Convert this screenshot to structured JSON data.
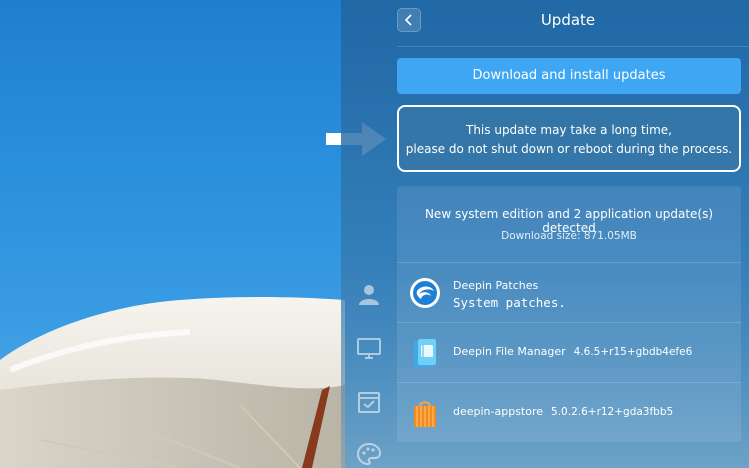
{
  "panel": {
    "title": "Update",
    "download_button_label": "Download and install updates",
    "warning": {
      "line1": "This update may take a long time,",
      "line2": "please do not shut down or reboot during the process."
    },
    "summary": {
      "title": "New system edition and 2 application update(s) detected",
      "size": "Download size: 871.05MB"
    },
    "items": [
      {
        "name": "Deepin Patches",
        "version": "",
        "description": "System patches.",
        "icon": "deepin-logo-icon"
      },
      {
        "name": "Deepin File Manager",
        "version": "4.6.5+r15+gbdb4efe6",
        "description": "",
        "icon": "file-manager-icon"
      },
      {
        "name": "deepin-appstore",
        "version": "5.0.2.6+r12+gda3fbb5",
        "description": "",
        "icon": "appstore-bag-icon"
      }
    ]
  },
  "rail_icons": [
    "user-icon",
    "display-icon",
    "calendar-check-icon",
    "palette-icon"
  ],
  "colors": {
    "accent": "#3ea6f2",
    "panel": "#2265a0",
    "wallpaper_sky": "#2a8fdc"
  }
}
